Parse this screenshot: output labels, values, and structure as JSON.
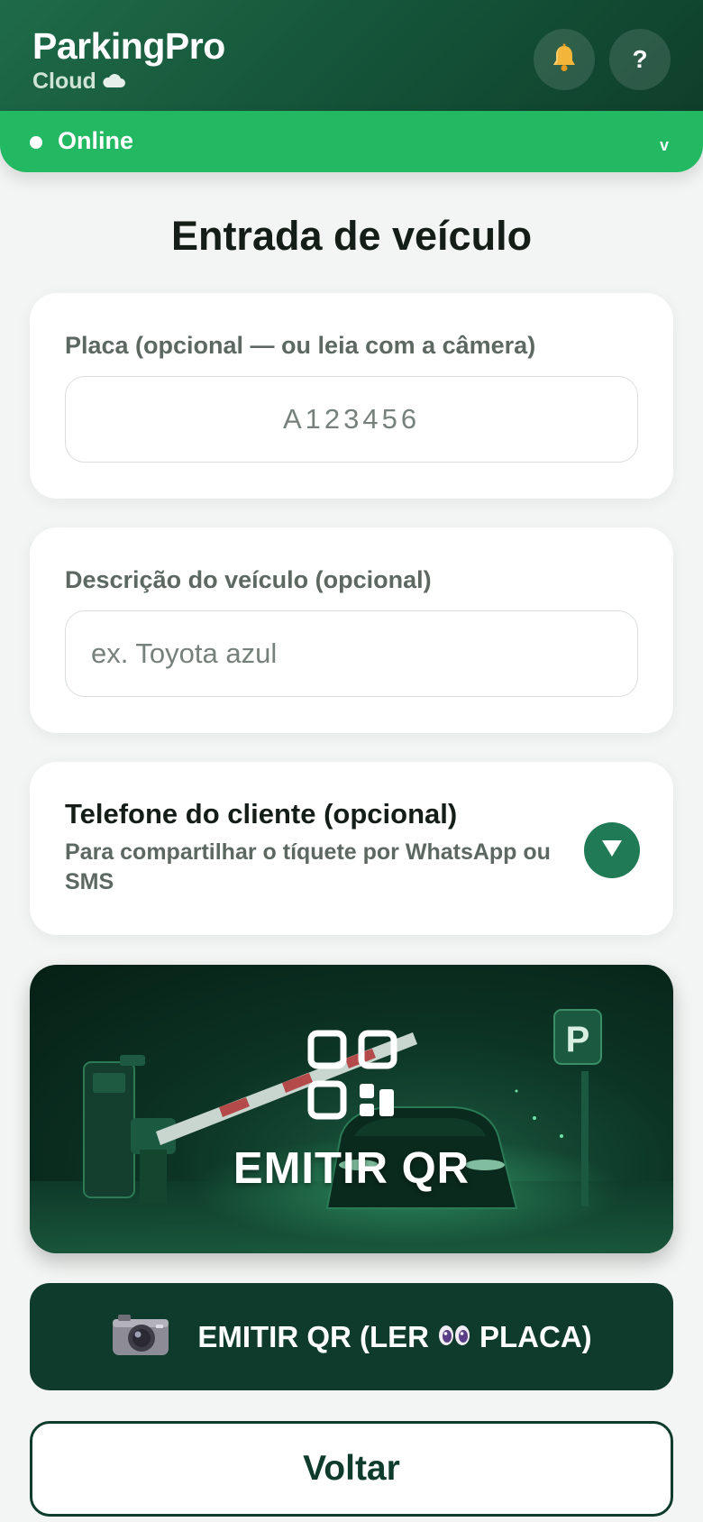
{
  "header": {
    "app_name": "ParkingPro",
    "app_sub": "Cloud",
    "icons": {
      "cloud": "cloud-icon",
      "bell": "bell-icon",
      "help": "help-icon"
    },
    "help_label": "?"
  },
  "status": {
    "label": "Online",
    "chevron": "v"
  },
  "page": {
    "title": "Entrada de veículo"
  },
  "plate_field": {
    "label": "Placa (opcional — ou leia com a câmera)",
    "placeholder": "A123456",
    "value": ""
  },
  "description_field": {
    "label": "Descrição do veículo (opcional)",
    "placeholder": "ex. Toyota azul",
    "value": ""
  },
  "phone_section": {
    "title": "Telefone do cliente (opcional)",
    "subtitle": "Para compartilhar o tíquete por WhatsApp ou SMS",
    "expand_icon": "triangle-down-icon"
  },
  "actions": {
    "emit_qr_label": "EMITIR QR",
    "emit_qr_scan_prefix": "EMITIR QR (LER",
    "emit_qr_scan_suffix": "PLACA)",
    "back_label": "Voltar"
  },
  "colors": {
    "header_green": "#145238",
    "status_green": "#23b862",
    "primary_dark": "#0e3b2b",
    "accent": "#1f7a55"
  }
}
